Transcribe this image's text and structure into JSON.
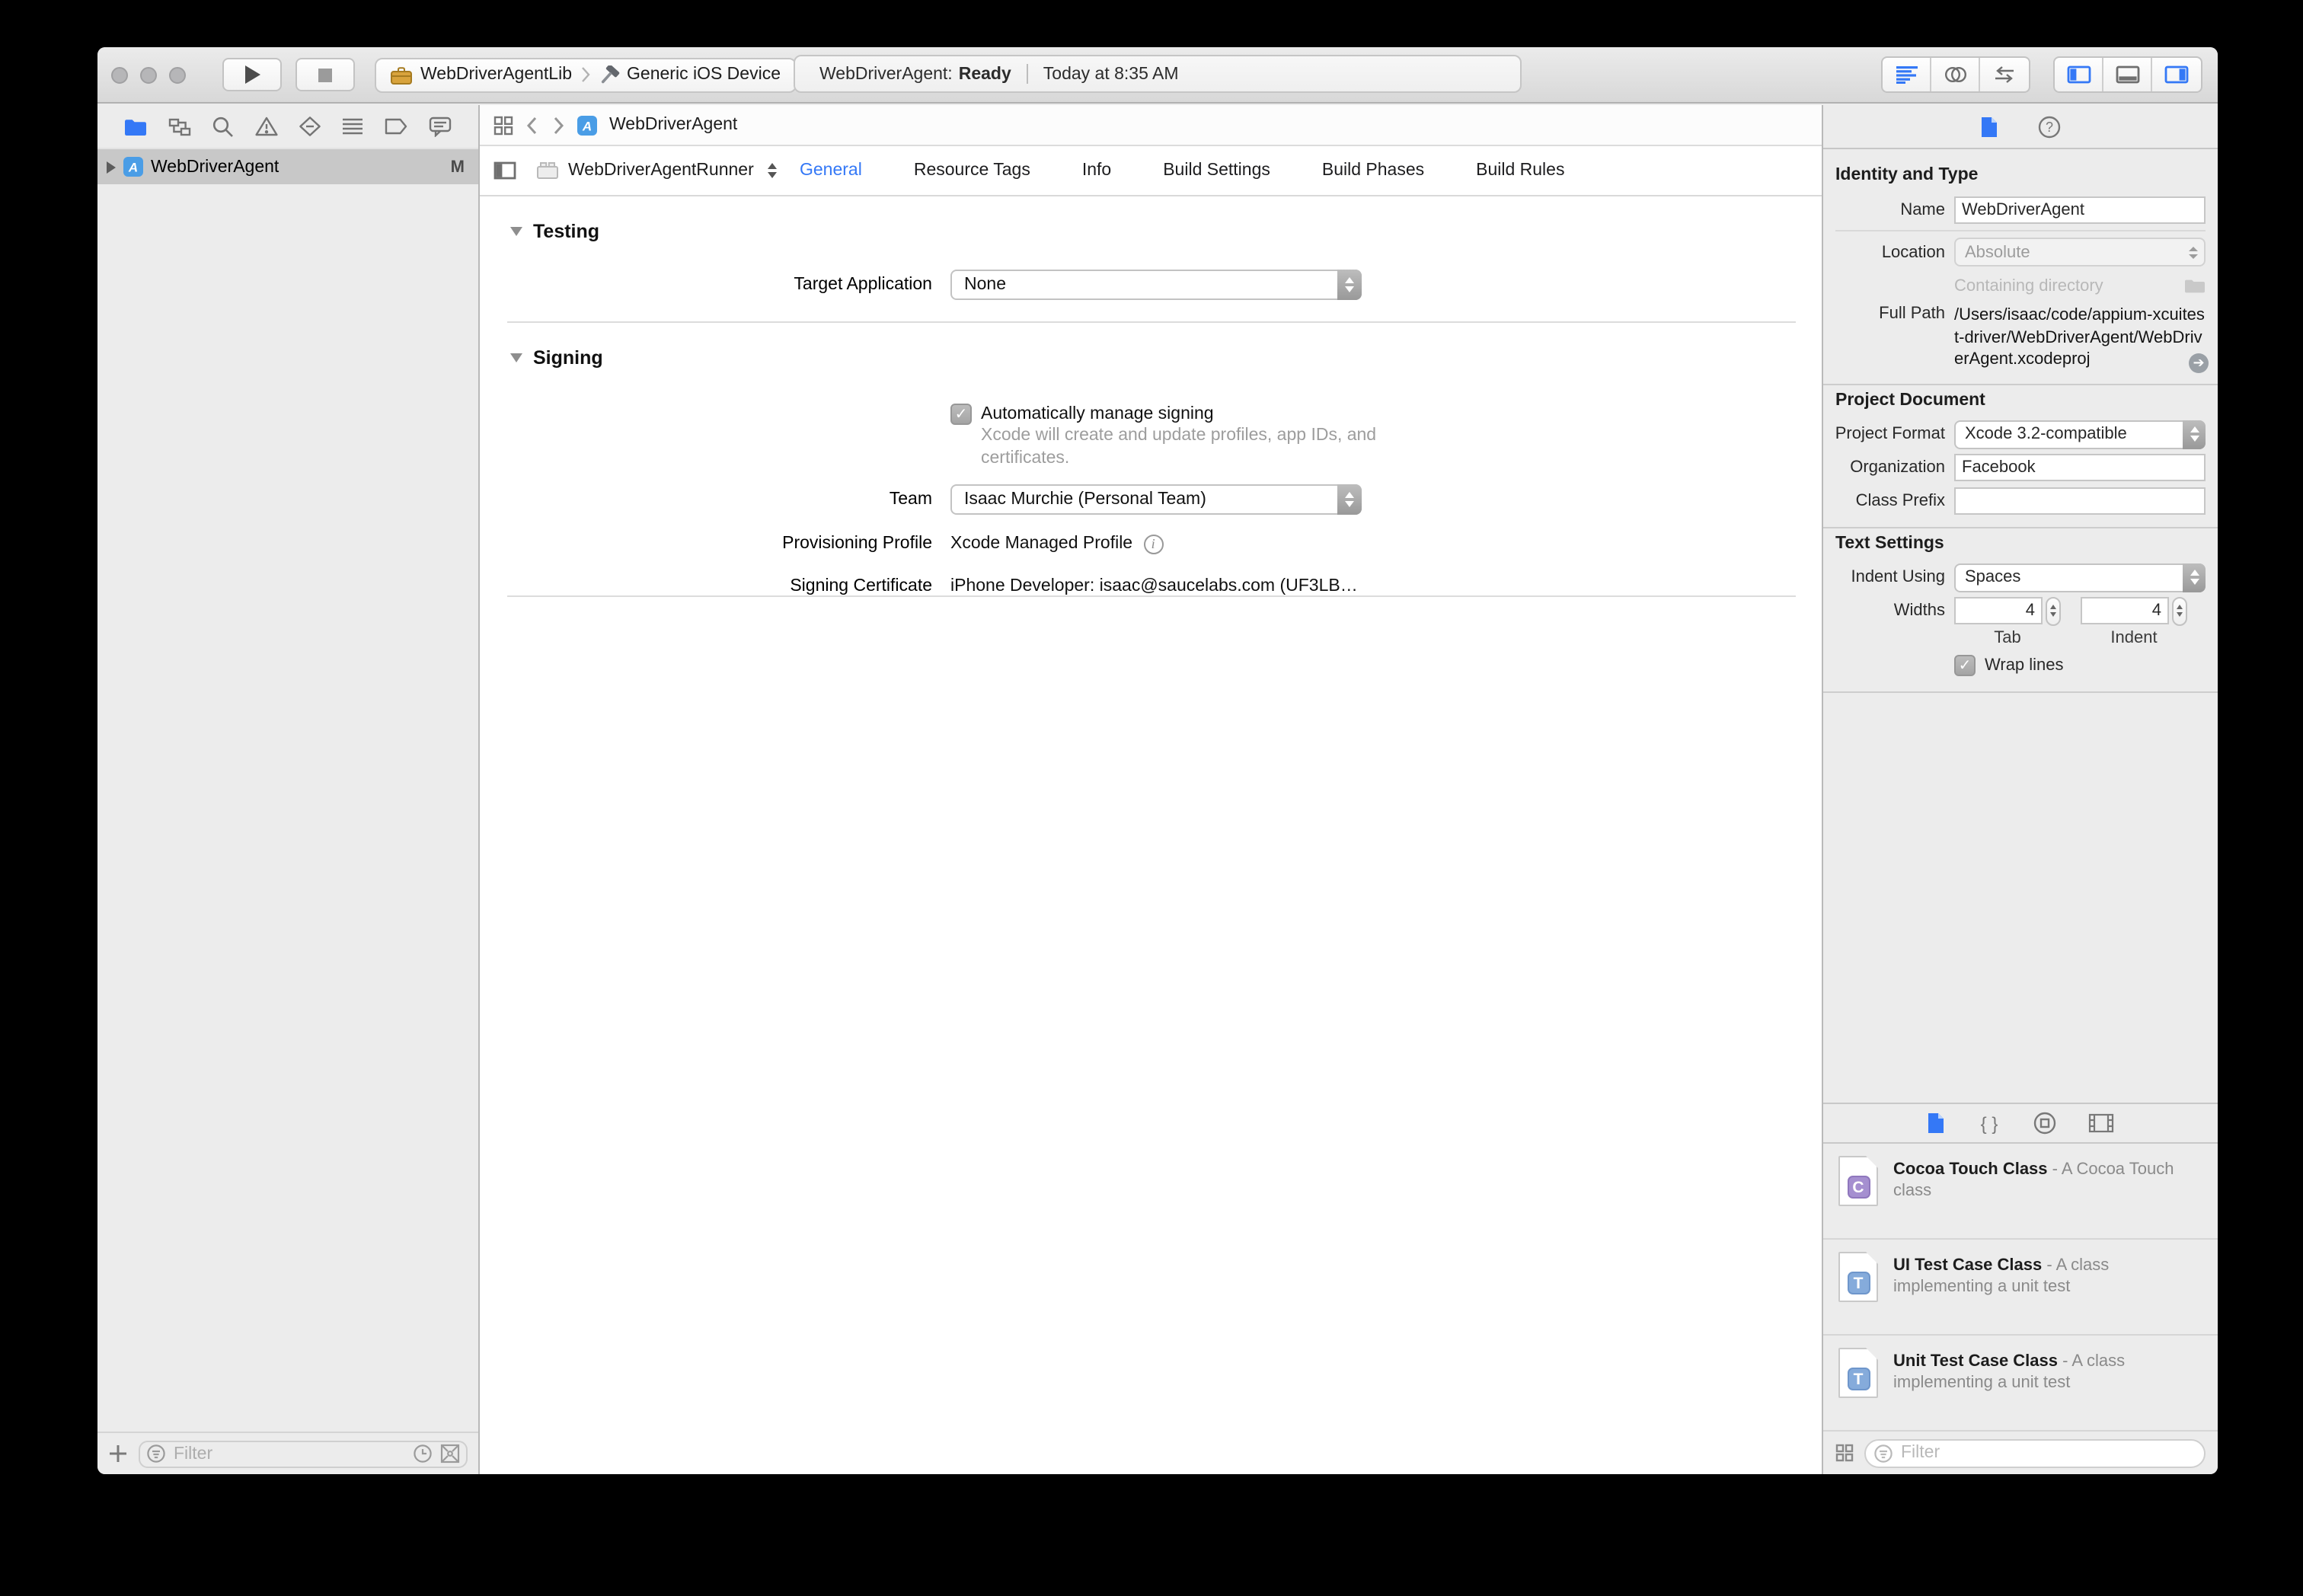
{
  "colors": {
    "accent_blue": "#3478f6",
    "selection_gray": "#c8c8c8",
    "library_c_icon": "#a58fd0",
    "library_t_icon": "#85abdb",
    "toolbox_icon": "#d8a33c"
  },
  "toolbar": {
    "scheme": "WebDriverAgentLib",
    "destination": "Generic iOS Device",
    "status_project": "WebDriverAgent:",
    "status_state": "Ready",
    "status_time": "Today at 8:35 AM"
  },
  "navigator": {
    "project": {
      "name": "WebDriverAgent",
      "badge": "M"
    },
    "filter_placeholder": "Filter"
  },
  "editor": {
    "jumpbar_file": "WebDriverAgent",
    "target_selector": "WebDriverAgentRunner",
    "tabs": [
      "General",
      "Resource Tags",
      "Info",
      "Build Settings",
      "Build Phases",
      "Build Rules"
    ],
    "selected_tab": "General",
    "testing": {
      "header": "Testing",
      "target_application_label": "Target Application",
      "target_application_value": "None"
    },
    "signing": {
      "header": "Signing",
      "auto_manage_label": "Automatically manage signing",
      "auto_manage_description": "Xcode will create and update profiles, app IDs, and certificates.",
      "team_label": "Team",
      "team_value": "Isaac Murchie (Personal Team)",
      "provisioning_label": "Provisioning Profile",
      "provisioning_value": "Xcode Managed Profile",
      "certificate_label": "Signing Certificate",
      "certificate_value": "iPhone Developer: isaac@saucelabs.com (UF3LB…"
    }
  },
  "inspector": {
    "identity": {
      "header": "Identity and Type",
      "name_label": "Name",
      "name_value": "WebDriverAgent",
      "location_label": "Location",
      "location_value": "Absolute",
      "containing_directory_placeholder": "Containing directory",
      "full_path_label": "Full Path",
      "full_path_value": "/Users/isaac/code/appium-xcuitest-driver/WebDriverAgent/WebDriverAgent.xcodeproj"
    },
    "project_document": {
      "header": "Project Document",
      "project_format_label": "Project Format",
      "project_format_value": "Xcode 3.2-compatible",
      "organization_label": "Organization",
      "organization_value": "Facebook",
      "class_prefix_label": "Class Prefix",
      "class_prefix_value": ""
    },
    "text_settings": {
      "header": "Text Settings",
      "indent_using_label": "Indent Using",
      "indent_using_value": "Spaces",
      "widths_label": "Widths",
      "tab_width_value": "4",
      "tab_width_label": "Tab",
      "indent_width_value": "4",
      "indent_width_label": "Indent",
      "wrap_lines_label": "Wrap lines"
    },
    "library": {
      "items": [
        {
          "letter": "C",
          "title": "Cocoa Touch Class",
          "description": " - A Cocoa Touch class"
        },
        {
          "letter": "T",
          "title": "UI Test Case Class",
          "description": " - A class implementing a unit test"
        },
        {
          "letter": "T",
          "title": "Unit Test Case Class",
          "description": " - A class implementing a unit test"
        }
      ],
      "filter_placeholder": "Filter"
    }
  }
}
